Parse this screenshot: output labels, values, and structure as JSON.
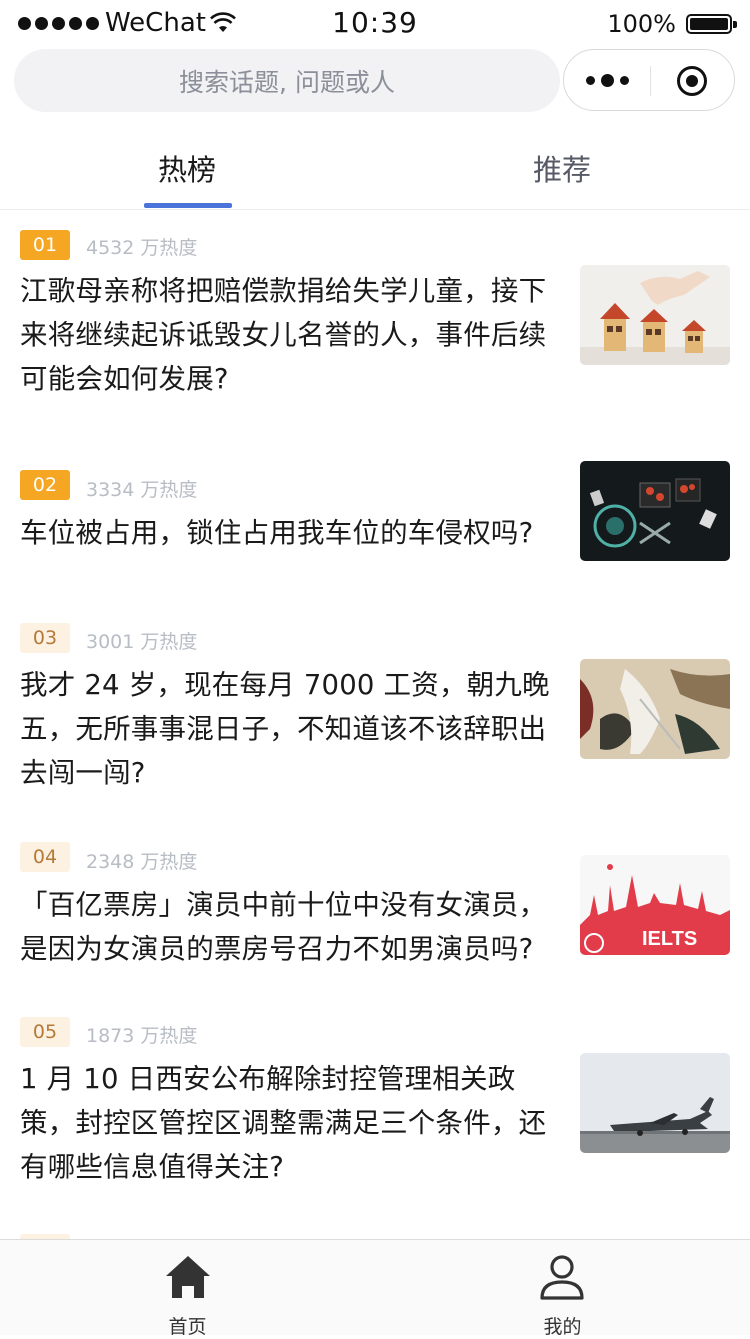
{
  "status_bar": {
    "carrier": "WeChat",
    "time": "10:39",
    "battery": "100%"
  },
  "search": {
    "placeholder": "搜索话题, 问题或人"
  },
  "capsule": {
    "more_icon": "more-dots-icon",
    "close_icon": "target-icon"
  },
  "tabs": [
    {
      "label": "热榜",
      "active": true
    },
    {
      "label": "推荐",
      "active": false
    }
  ],
  "items": [
    {
      "rank": "01",
      "heat": "4532 万热度",
      "lines": [
        "江歌母亲称将把赔偿款捐给失学儿童，接下",
        "来将继续起诉诋毁女儿名誉的人，事件后续",
        "可能会如何发展?"
      ],
      "thumb": "houses-thumbnail"
    },
    {
      "rank": "02",
      "heat": "3334 万热度",
      "lines": [
        "车位被占用，锁住占用我车位的车侵权吗?"
      ],
      "thumb": "dark-tech-thumbnail"
    },
    {
      "rank": "03",
      "heat": "3001 万热度",
      "lines": [
        "我才 24 岁，现在每月 7000 工资，朝九晚",
        "五，无所事事混日子，不知道该不该辞职出",
        "去闯一闯?"
      ],
      "thumb": "art-thumbnail"
    },
    {
      "rank": "04",
      "heat": "2348 万热度",
      "lines": [
        "「百亿票房」演员中前十位中没有女演员，",
        "是因为女演员的票房号召力不如男演员吗?"
      ],
      "thumb": "ielts-thumbnail"
    },
    {
      "rank": "05",
      "heat": "1873 万热度",
      "lines": [
        "1 月 10 日西安公布解除封控管理相关政",
        "策，封控区管控区调整需满足三个条件，还",
        "有哪些信息值得关注?"
      ],
      "thumb": "jet-thumbnail"
    }
  ],
  "thumb_text": {
    "ielts": "IELTS"
  },
  "tabbar": [
    {
      "label": "首页",
      "icon": "home-icon"
    },
    {
      "label": "我的",
      "icon": "user-icon"
    }
  ],
  "colors": {
    "accent": "#4a74d9",
    "rank_hot": "#f5a623",
    "rank_warm_bg": "#fdf1e2"
  }
}
